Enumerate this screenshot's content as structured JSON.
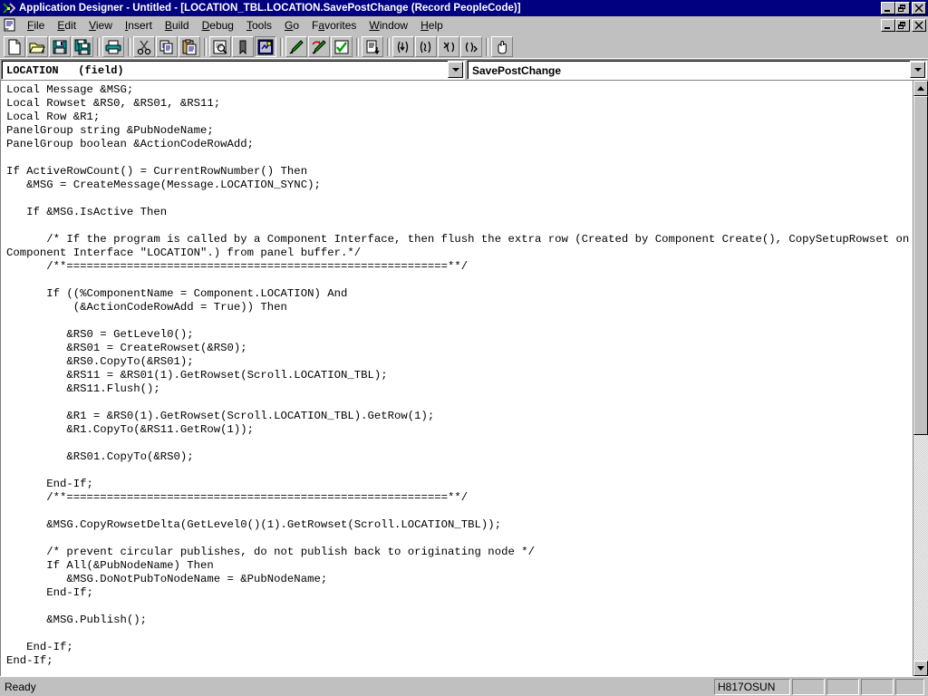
{
  "window": {
    "title": "Application Designer - Untitled - [LOCATION_TBL.LOCATION.SavePostChange (Record PeopleCode)]",
    "app_icon": "application-designer-icon",
    "buttons": {
      "minimize": "minimize",
      "restore": "restore",
      "close": "close"
    }
  },
  "menu": {
    "doc_icon": "document-icon",
    "items": [
      {
        "label": "File",
        "accel": "F"
      },
      {
        "label": "Edit",
        "accel": "E"
      },
      {
        "label": "View",
        "accel": "V"
      },
      {
        "label": "Insert",
        "accel": "I"
      },
      {
        "label": "Build",
        "accel": "B"
      },
      {
        "label": "Debug",
        "accel": "D"
      },
      {
        "label": "Tools",
        "accel": "T"
      },
      {
        "label": "Go",
        "accel": "G"
      },
      {
        "label": "Favorites",
        "accel": "a"
      },
      {
        "label": "Window",
        "accel": "W"
      },
      {
        "label": "Help",
        "accel": "H"
      }
    ],
    "mdi_buttons": {
      "minimize": "minimize",
      "restore": "restore",
      "close": "close"
    }
  },
  "toolbar": {
    "groups": [
      [
        "new-file-icon",
        "open-folder-icon",
        "save-icon",
        "save-all-icon"
      ],
      [
        "print-icon"
      ],
      [
        "cut-scissors-icon",
        "copy-icon",
        "paste-icon"
      ],
      [
        "find-in-files-icon",
        "bookmark-icon",
        "project-workspace-icon"
      ],
      [
        "validate-syntax-icon",
        "view-definition-icon",
        "checkmark-icon"
      ],
      [
        "code-listing-icon"
      ],
      [
        "step-into-icon",
        "step-over-icon",
        "go-to-brace-start-icon",
        "go-to-brace-end-icon"
      ],
      [
        "hand-pan-icon"
      ]
    ]
  },
  "selectors": {
    "field": {
      "value": "LOCATION   (field)",
      "dropdown": "chevron-down-icon"
    },
    "event": {
      "value": "SavePostChange",
      "dropdown": "chevron-down-icon"
    }
  },
  "editor": {
    "code": "Local Message &MSG;\nLocal Rowset &RS0, &RS01, &RS11;\nLocal Row &R1;\nPanelGroup string &PubNodeName;\nPanelGroup boolean &ActionCodeRowAdd;\n\nIf ActiveRowCount() = CurrentRowNumber() Then\n   &MSG = CreateMessage(Message.LOCATION_SYNC);\n\n   If &MSG.IsActive Then\n\n      /* If the program is called by a Component Interface, then flush the extra row (Created by Component Create(), CopySetupRowset on\nComponent Interface \"LOCATION\".) from panel buffer.*/\n      /**=========================================================**/\n\n      If ((%ComponentName = Component.LOCATION) And\n          (&ActionCodeRowAdd = True)) Then\n\n         &RS0 = GetLevel0();\n         &RS01 = CreateRowset(&RS0);\n         &RS0.CopyTo(&RS01);\n         &RS11 = &RS01(1).GetRowset(Scroll.LOCATION_TBL);\n         &RS11.Flush();\n\n         &R1 = &RS0(1).GetRowset(Scroll.LOCATION_TBL).GetRow(1);\n         &R1.CopyTo(&RS11.GetRow(1));\n\n         &RS01.CopyTo(&RS0);\n\n      End-If;\n      /**=========================================================**/\n\n      &MSG.CopyRowsetDelta(GetLevel0()(1).GetRowset(Scroll.LOCATION_TBL));\n\n      /* prevent circular publishes, do not publish back to originating node */\n      If All(&PubNodeName) Then\n         &MSG.DoNotPubToNodeName = &PubNodeName;\n      End-If;\n\n      &MSG.Publish();\n\n   End-If;\nEnd-If;"
  },
  "scrollbar": {
    "up_arrow": "scroll-up-icon",
    "down_arrow": "scroll-down-icon",
    "thumb_top_pct": 0,
    "thumb_height_pct": 60
  },
  "statusbar": {
    "message": "Ready",
    "database": "H817OSUN",
    "panel2": "",
    "panel3": "",
    "panel4": "",
    "panel5": ""
  },
  "colors": {
    "title_active": "#000080",
    "face": "#c0c0c0",
    "editor_bg": "#ffffff",
    "text": "#000000"
  }
}
